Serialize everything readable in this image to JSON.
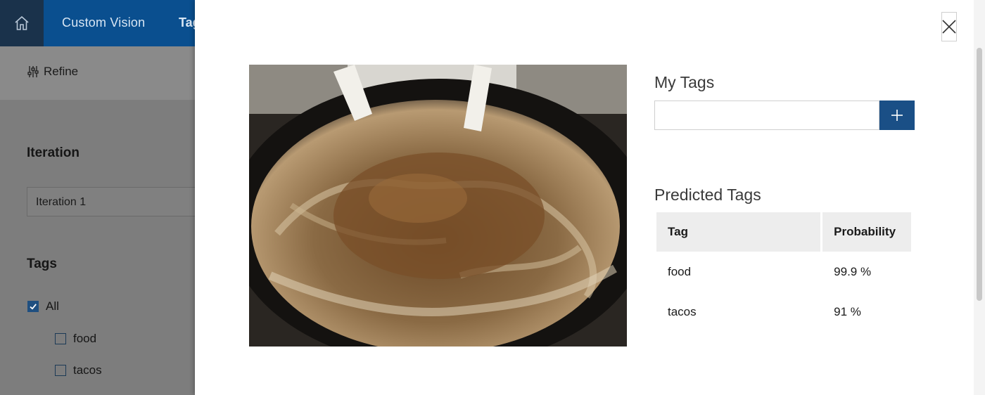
{
  "app": {
    "title": "Custom Vision",
    "partial_tab": "Tag",
    "refine_label": "Refine"
  },
  "sidebar": {
    "iteration_heading": "Iteration",
    "iteration_value": "Iteration 1",
    "tags_heading": "Tags",
    "tags": [
      {
        "label": "All",
        "checked": true
      },
      {
        "label": "food",
        "checked": false
      },
      {
        "label": "tacos",
        "checked": false
      }
    ]
  },
  "modal": {
    "my_tags_heading": "My Tags",
    "tag_input_value": "",
    "tag_input_placeholder": "",
    "add_button_icon": "plus-icon",
    "close_button_icon": "close-icon",
    "predicted_tags_heading": "Predicted Tags",
    "table": {
      "headers": [
        "Tag",
        "Probability"
      ],
      "rows": [
        {
          "tag": "food",
          "probability": "99.9 %"
        },
        {
          "tag": "tacos",
          "probability": "91 %"
        }
      ]
    }
  },
  "colors": {
    "topbar": "#0a4f8f",
    "home": "#1a324b",
    "accent": "#1a4f86",
    "overlay_gray": "#7d7d7d"
  }
}
